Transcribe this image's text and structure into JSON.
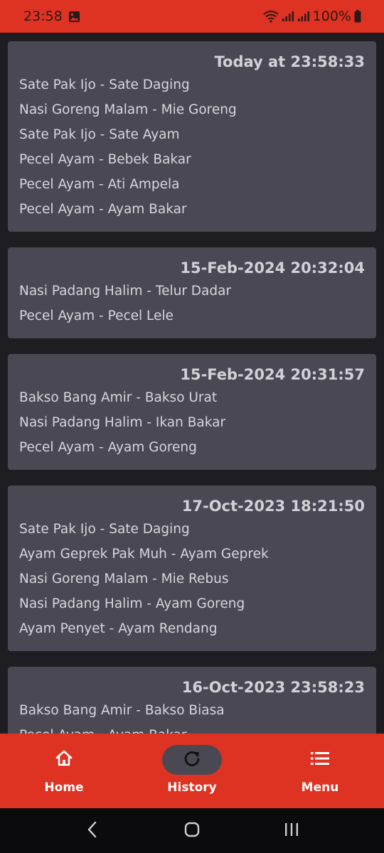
{
  "status_bar": {
    "time": "23:58",
    "battery": "100%"
  },
  "history": [
    {
      "date": "Today at 23:58:33",
      "items": [
        "Sate Pak Ijo - Sate Daging",
        "Nasi Goreng Malam - Mie Goreng",
        "Sate Pak Ijo - Sate Ayam",
        "Pecel Ayam - Bebek Bakar",
        "Pecel Ayam - Ati Ampela",
        "Pecel Ayam - Ayam Bakar"
      ]
    },
    {
      "date": "15-Feb-2024 20:32:04",
      "items": [
        "Nasi Padang Halim - Telur Dadar",
        "Pecel Ayam - Pecel Lele"
      ]
    },
    {
      "date": "15-Feb-2024 20:31:57",
      "items": [
        "Bakso Bang Amir - Bakso Urat",
        "Nasi Padang Halim - Ikan Bakar",
        "Pecel Ayam - Ayam Goreng"
      ]
    },
    {
      "date": "17-Oct-2023 18:21:50",
      "items": [
        "Sate Pak Ijo - Sate Daging",
        "Ayam Geprek Pak Muh - Ayam Geprek",
        "Nasi Goreng Malam - Mie Rebus",
        "Nasi Padang Halim - Ayam Goreng",
        "Ayam Penyet - Ayam Rendang"
      ]
    },
    {
      "date": "16-Oct-2023 23:58:23",
      "items": [
        "Bakso Bang Amir - Bakso Biasa",
        "Pecel Ayam - Ayam Bakar"
      ]
    }
  ],
  "bottom_nav": {
    "home_label": "Home",
    "history_label": "History",
    "menu_label": "Menu",
    "active": "history"
  },
  "colors": {
    "primary": "#de3222",
    "card": "#4a4853",
    "background": "#1e1d22"
  },
  "icons": {
    "home": "home-icon",
    "history": "refresh-icon",
    "menu": "list-icon"
  }
}
